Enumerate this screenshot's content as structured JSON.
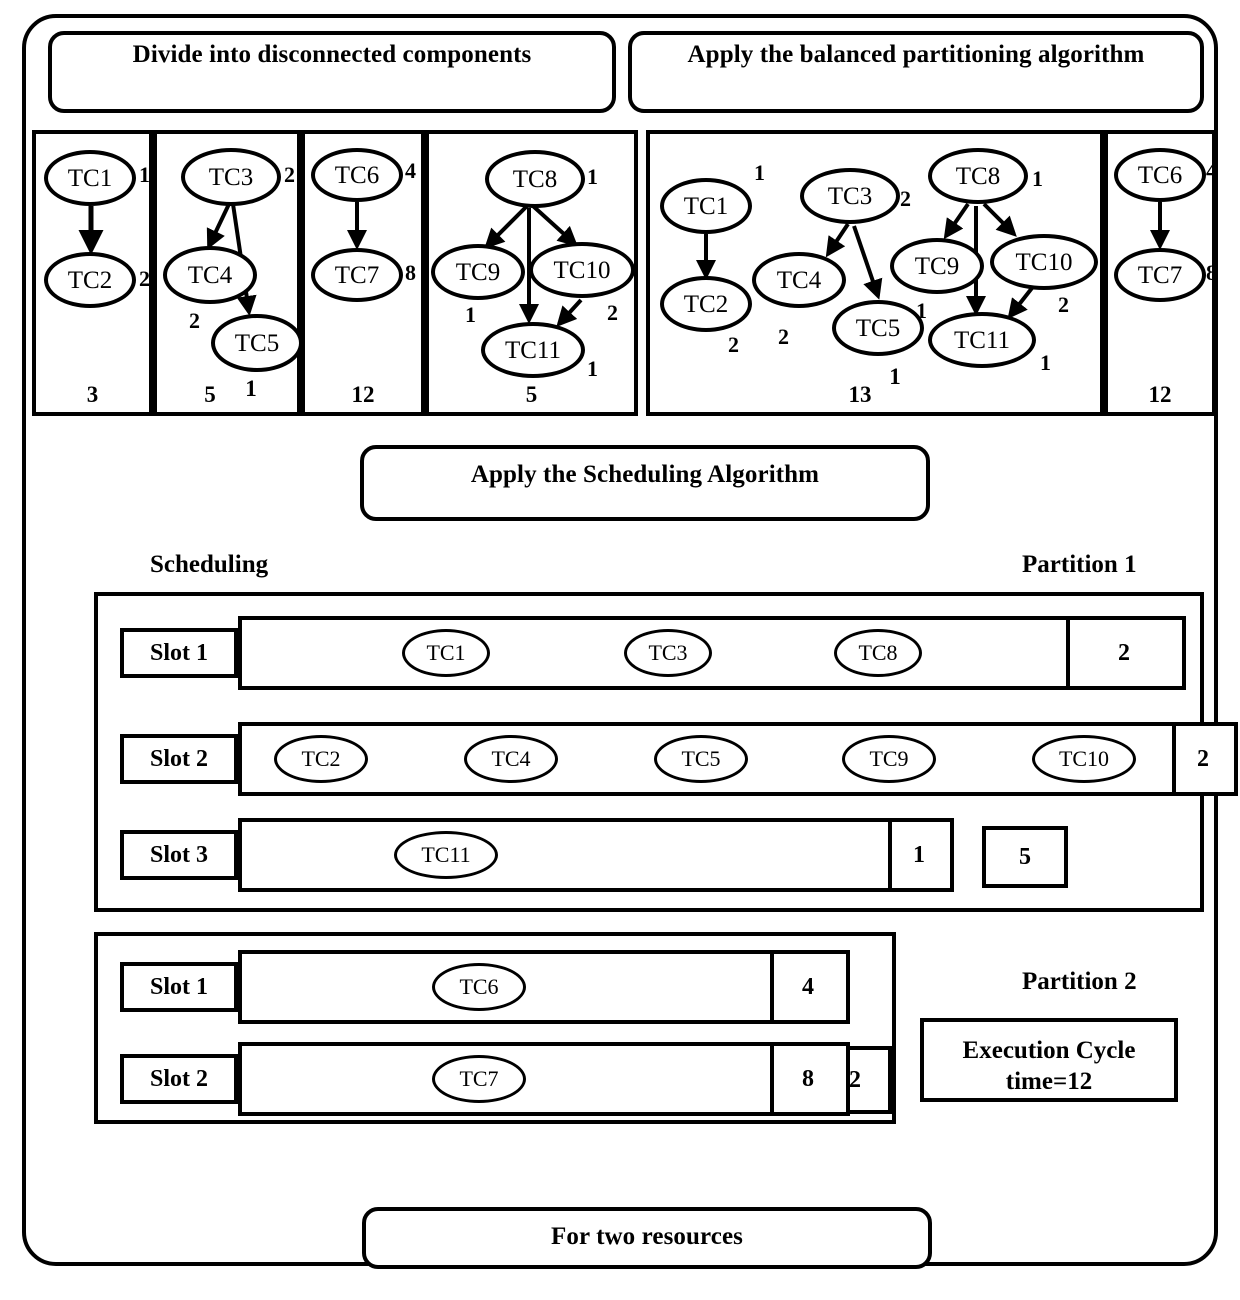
{
  "headers": {
    "divide": "Divide into disconnected components",
    "balanced": "Apply the balanced partitioning algorithm",
    "scheduling": "Apply the Scheduling Algorithm",
    "resources": "For two resources"
  },
  "labels": {
    "scheduling": "Scheduling",
    "partition1": "Partition 1",
    "partition2": "Partition 2",
    "execution_cycle_line1": "Execution Cycle",
    "execution_cycle_line2": "time=12"
  },
  "components": [
    {
      "name": "component-1",
      "total": "3",
      "nodes": [
        {
          "id": "TC1",
          "weight": "1"
        },
        {
          "id": "TC2",
          "weight": "2"
        }
      ],
      "edges": [
        [
          "TC1",
          "TC2"
        ]
      ]
    },
    {
      "name": "component-2",
      "total": "5",
      "extra": "1",
      "nodes": [
        {
          "id": "TC3",
          "weight": "2"
        },
        {
          "id": "TC4",
          "weight": "2"
        },
        {
          "id": "TC5",
          "weight": ""
        }
      ],
      "edges": [
        [
          "TC3",
          "TC4"
        ],
        [
          "TC3",
          "TC5"
        ]
      ]
    },
    {
      "name": "component-3",
      "total": "12",
      "nodes": [
        {
          "id": "TC6",
          "weight": "4"
        },
        {
          "id": "TC7",
          "weight": "8"
        }
      ],
      "edges": [
        [
          "TC6",
          "TC7"
        ]
      ]
    },
    {
      "name": "component-4",
      "total": "5",
      "nodes": [
        {
          "id": "TC8",
          "weight": "1"
        },
        {
          "id": "TC9",
          "weight": "1"
        },
        {
          "id": "TC10",
          "weight": "2"
        },
        {
          "id": "TC11",
          "weight": "1"
        }
      ],
      "edges": [
        [
          "TC8",
          "TC9"
        ],
        [
          "TC8",
          "TC11"
        ],
        [
          "TC8",
          "TC10"
        ],
        [
          "TC10",
          "TC11"
        ]
      ]
    }
  ],
  "partitions_graph": [
    {
      "name": "balanced-partition-1",
      "total": "13",
      "extra": "1",
      "nodes": [
        {
          "id": "TC1",
          "weight": "1"
        },
        {
          "id": "TC2",
          "weight": "2"
        },
        {
          "id": "TC3",
          "weight": "2"
        },
        {
          "id": "TC4",
          "weight": "2"
        },
        {
          "id": "TC5",
          "weight": "1"
        },
        {
          "id": "TC8",
          "weight": "1"
        },
        {
          "id": "TC9",
          "weight": ""
        },
        {
          "id": "TC10",
          "weight": "2"
        },
        {
          "id": "TC11",
          "weight": "1"
        }
      ]
    },
    {
      "name": "balanced-partition-2",
      "total": "12",
      "nodes": [
        {
          "id": "TC6",
          "weight": "4"
        },
        {
          "id": "TC7",
          "weight": "8"
        }
      ]
    }
  ],
  "schedule": {
    "partition1": {
      "title": "Partition 1",
      "total": "5",
      "slots": [
        {
          "label": "Slot 1",
          "tasks": [
            "TC1",
            "TC3",
            "TC8"
          ],
          "cost": "2"
        },
        {
          "label": "Slot 2",
          "tasks": [
            "TC2",
            "TC4",
            "TC5",
            "TC9",
            "TC10"
          ],
          "cost": "2"
        },
        {
          "label": "Slot 3",
          "tasks": [
            "TC11"
          ],
          "cost": "1"
        }
      ]
    },
    "partition2": {
      "title": "Partition 2",
      "total": "12",
      "slots": [
        {
          "label": "Slot 1",
          "tasks": [
            "TC6"
          ],
          "cost": "4"
        },
        {
          "label": "Slot 2",
          "tasks": [
            "TC7"
          ],
          "cost": "8"
        }
      ]
    }
  }
}
